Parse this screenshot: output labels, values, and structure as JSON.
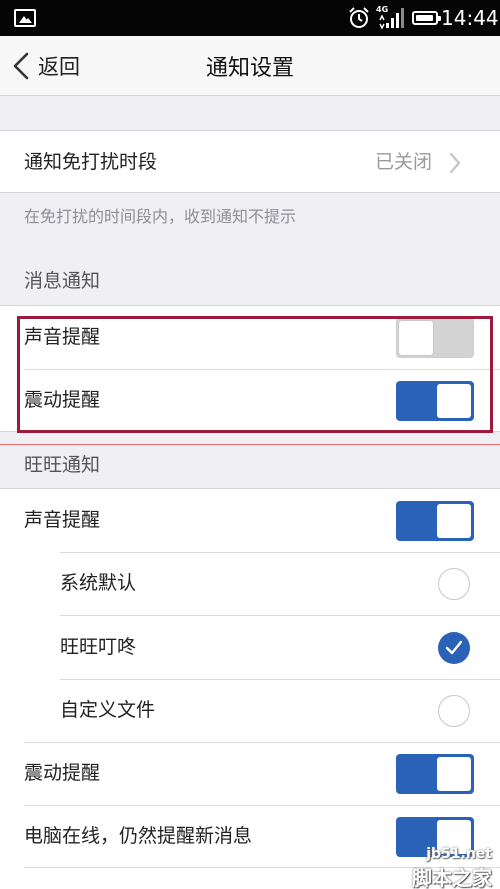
{
  "status_bar": {
    "time": "14:44",
    "network_type": "4G",
    "icons": [
      "gallery-icon",
      "alarm-icon",
      "signal-icon",
      "battery-icon"
    ]
  },
  "nav": {
    "back_label": "返回",
    "title": "通知设置"
  },
  "dnd": {
    "label": "通知免打扰时段",
    "value": "已关闭",
    "hint": "在免打扰的时间段内，收到通知不提示"
  },
  "message_notifications": {
    "section_label": "消息通知",
    "sound": {
      "label": "声音提醒",
      "on": false
    },
    "vibrate": {
      "label": "震动提醒",
      "on": true
    }
  },
  "wangwang_notifications": {
    "section_label": "旺旺通知",
    "sound": {
      "label": "声音提醒",
      "on": true
    },
    "tones": [
      {
        "label": "系统默认",
        "selected": false
      },
      {
        "label": "旺旺叮咚",
        "selected": true
      },
      {
        "label": "自定义文件",
        "selected": false
      }
    ],
    "vibrate": {
      "label": "震动提醒",
      "on": true
    },
    "pc_online": {
      "label": "电脑在线，仍然提醒新消息",
      "on": true
    }
  },
  "watermark": {
    "url": "jb51.net",
    "name": "脚本之家"
  },
  "colors": {
    "accent": "#2a62b8",
    "annotation": "#9b1b3a",
    "background": "#efeff4"
  }
}
